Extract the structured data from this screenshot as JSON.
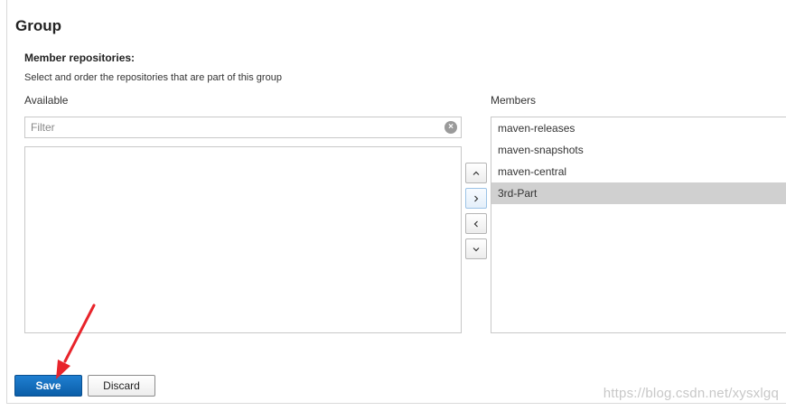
{
  "group": {
    "title": "Group",
    "field_label": "Member repositories:",
    "field_help": "Select and order the repositories that are part of this group"
  },
  "available": {
    "label": "Available",
    "filter_placeholder": "Filter",
    "filter_value": "",
    "items": []
  },
  "members": {
    "label": "Members",
    "items": [
      {
        "label": "maven-releases",
        "selected": false
      },
      {
        "label": "maven-snapshots",
        "selected": false
      },
      {
        "label": "maven-central",
        "selected": false
      },
      {
        "label": "3rd-Part",
        "selected": true
      }
    ]
  },
  "controls": {
    "icons": [
      "chevron-up-icon",
      "chevron-right-icon",
      "chevron-left-icon",
      "chevron-down-icon"
    ]
  },
  "actions": {
    "save_label": "Save",
    "discard_label": "Discard"
  },
  "annotation": {
    "arrow_color": "#e8242b"
  },
  "watermark": "https://blog.csdn.net/xysxlgq",
  "colors": {
    "save_button": "#1470c0",
    "selected_row": "#d0d0d0"
  }
}
